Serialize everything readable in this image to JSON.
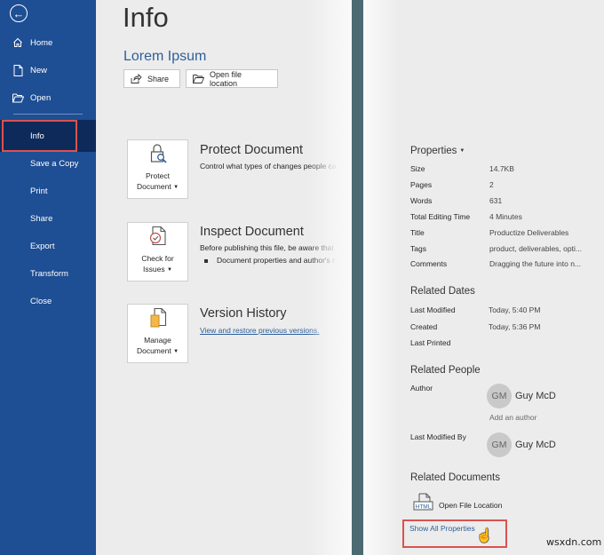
{
  "sidebar": {
    "back_icon": "back-arrow-icon",
    "items": [
      {
        "label": "Home",
        "icon": "home-icon"
      },
      {
        "label": "New",
        "icon": "new-document-icon"
      },
      {
        "label": "Open",
        "icon": "open-folder-icon"
      },
      {
        "label": "Info",
        "active": true
      },
      {
        "label": "Save a Copy"
      },
      {
        "label": "Print"
      },
      {
        "label": "Share"
      },
      {
        "label": "Export"
      },
      {
        "label": "Transform"
      },
      {
        "label": "Close"
      }
    ],
    "background": "#1e4e93",
    "active_background": "#0e2a5a"
  },
  "center": {
    "title": "Info",
    "document_name": "Lorem Ipsum",
    "share_label": "Share",
    "open_location_label": "Open file location",
    "sections": [
      {
        "tile_line1": "Protect",
        "tile_line2": "Document",
        "icon": "lock-key-icon",
        "title": "Protect Document",
        "desc": "Control what types of changes people ca"
      },
      {
        "tile_line1": "Check for",
        "tile_line2": "Issues",
        "icon": "check-document-icon",
        "title": "Inspect Document",
        "desc": "Before publishing this file, be aware that",
        "bullet": "Document properties and author's r"
      },
      {
        "tile_line1": "Manage",
        "tile_line2": "Document",
        "icon": "manage-document-icon",
        "title": "Version History",
        "link": "View and restore previous versions."
      }
    ]
  },
  "properties": {
    "heading": "Properties",
    "rows": [
      {
        "key": "Size",
        "value": "14.7KB"
      },
      {
        "key": "Pages",
        "value": "2"
      },
      {
        "key": "Words",
        "value": "631"
      },
      {
        "key": "Total Editing Time",
        "value": "4 Minutes"
      },
      {
        "key": "Title",
        "value": "Productize Deliverables"
      },
      {
        "key": "Tags",
        "value": "product, deliverables, opti..."
      },
      {
        "key": "Comments",
        "value": "Dragging the future into n..."
      }
    ]
  },
  "related_dates": {
    "heading": "Related Dates",
    "rows": [
      {
        "key": "Last Modified",
        "value": "Today, 5:40 PM"
      },
      {
        "key": "Created",
        "value": "Today, 5:36 PM"
      },
      {
        "key": "Last Printed",
        "value": ""
      }
    ]
  },
  "related_people": {
    "heading": "Related People",
    "author_label": "Author",
    "author_initials": "GM",
    "author_name": "Guy McD",
    "add_author": "Add an author",
    "last_modified_label": "Last Modified By",
    "last_modified_initials": "GM",
    "last_modified_name": "Guy McD"
  },
  "related_documents": {
    "heading": "Related Documents",
    "open_file_location": "Open File Location",
    "file_icon_text": "HTML",
    "show_all": "Show All Properties"
  },
  "watermark": "wsxdn.com",
  "colors": {
    "accent_link": "#2e5f99",
    "highlight_border": "#d9534f",
    "divider": "#4c6a72"
  }
}
